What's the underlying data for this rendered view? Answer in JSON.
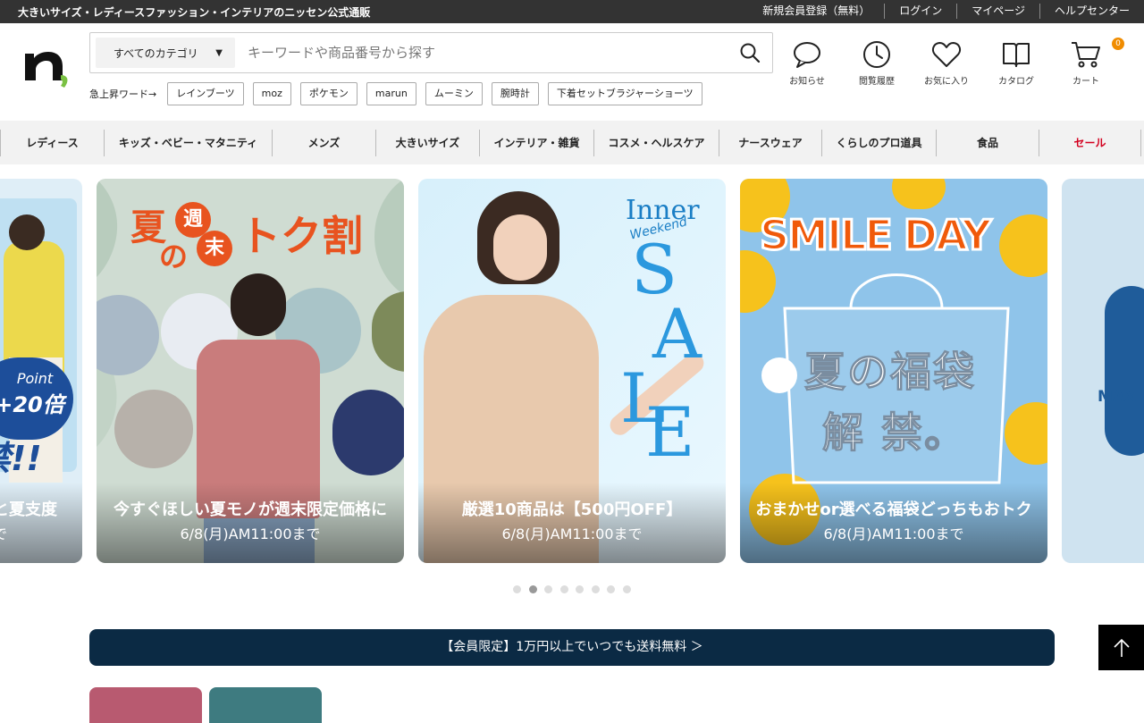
{
  "topbar": {
    "tagline": "大きいサイズ・レディースファッション・インテリアのニッセン公式通販",
    "links": [
      "新規会員登録（無料）",
      "ログイン",
      "マイページ",
      "ヘルプセンター"
    ]
  },
  "search": {
    "category": "すべてのカテゴリ",
    "placeholder": "キーワードや商品番号から探す"
  },
  "trending": {
    "label": "急上昇ワード→",
    "tags": [
      "レインブーツ",
      "moz",
      "ポケモン",
      "marun",
      "ムーミン",
      "腕時計",
      "下着セットブラジャーショーツ"
    ]
  },
  "header_icons": {
    "notice": "お知らせ",
    "history": "閲覧履歴",
    "favorites": "お気に入り",
    "catalog": "カタログ",
    "cart": "カート",
    "cart_count": "0"
  },
  "nav": [
    "レディース",
    "キッズ・ベビー・マタニティ",
    "メンズ",
    "大きいサイズ",
    "インテリア・雑貨",
    "コスメ・ヘルスケア",
    "ナースウェア",
    "くらしのプロ道具",
    "食品",
    "セール"
  ],
  "slides": [
    {
      "line1": "と夏支度",
      "line2": "で",
      "badge_point": "Point",
      "badge_num": "+20倍",
      "big": "禁!!"
    },
    {
      "line1": "今すぐほしい夏モノが週末限定価格に",
      "line2": "6/8(月)AM11:00まで",
      "h1": "夏",
      "h2": "週",
      "h3": "末",
      "h4": "の",
      "h5": "トク割"
    },
    {
      "line1": "厳選10商品は【500円OFF】",
      "line2": "6/8(月)AM11:00まで",
      "inner": "Inner",
      "weekend": "Weekend",
      "s": "S",
      "a": "A",
      "l": "L",
      "e": "E"
    },
    {
      "line1": "おまかせor選べる福袋どっちもおトク",
      "line2": "6/8(月)AM11:00まで",
      "smile": "SMILE DAY",
      "fuku1": "夏の福袋",
      "fuku2": "解 禁。"
    },
    {
      "max": "MAX"
    }
  ],
  "member_bar": "【会員限定】1万円以上でいつでも送料無料 ＞",
  "colors": {
    "accent_orange": "#f08c00",
    "sale_red": "#d3001f",
    "navy": "#0b2a44",
    "tile1": "#b85a70",
    "tile2": "#3e7b80"
  }
}
